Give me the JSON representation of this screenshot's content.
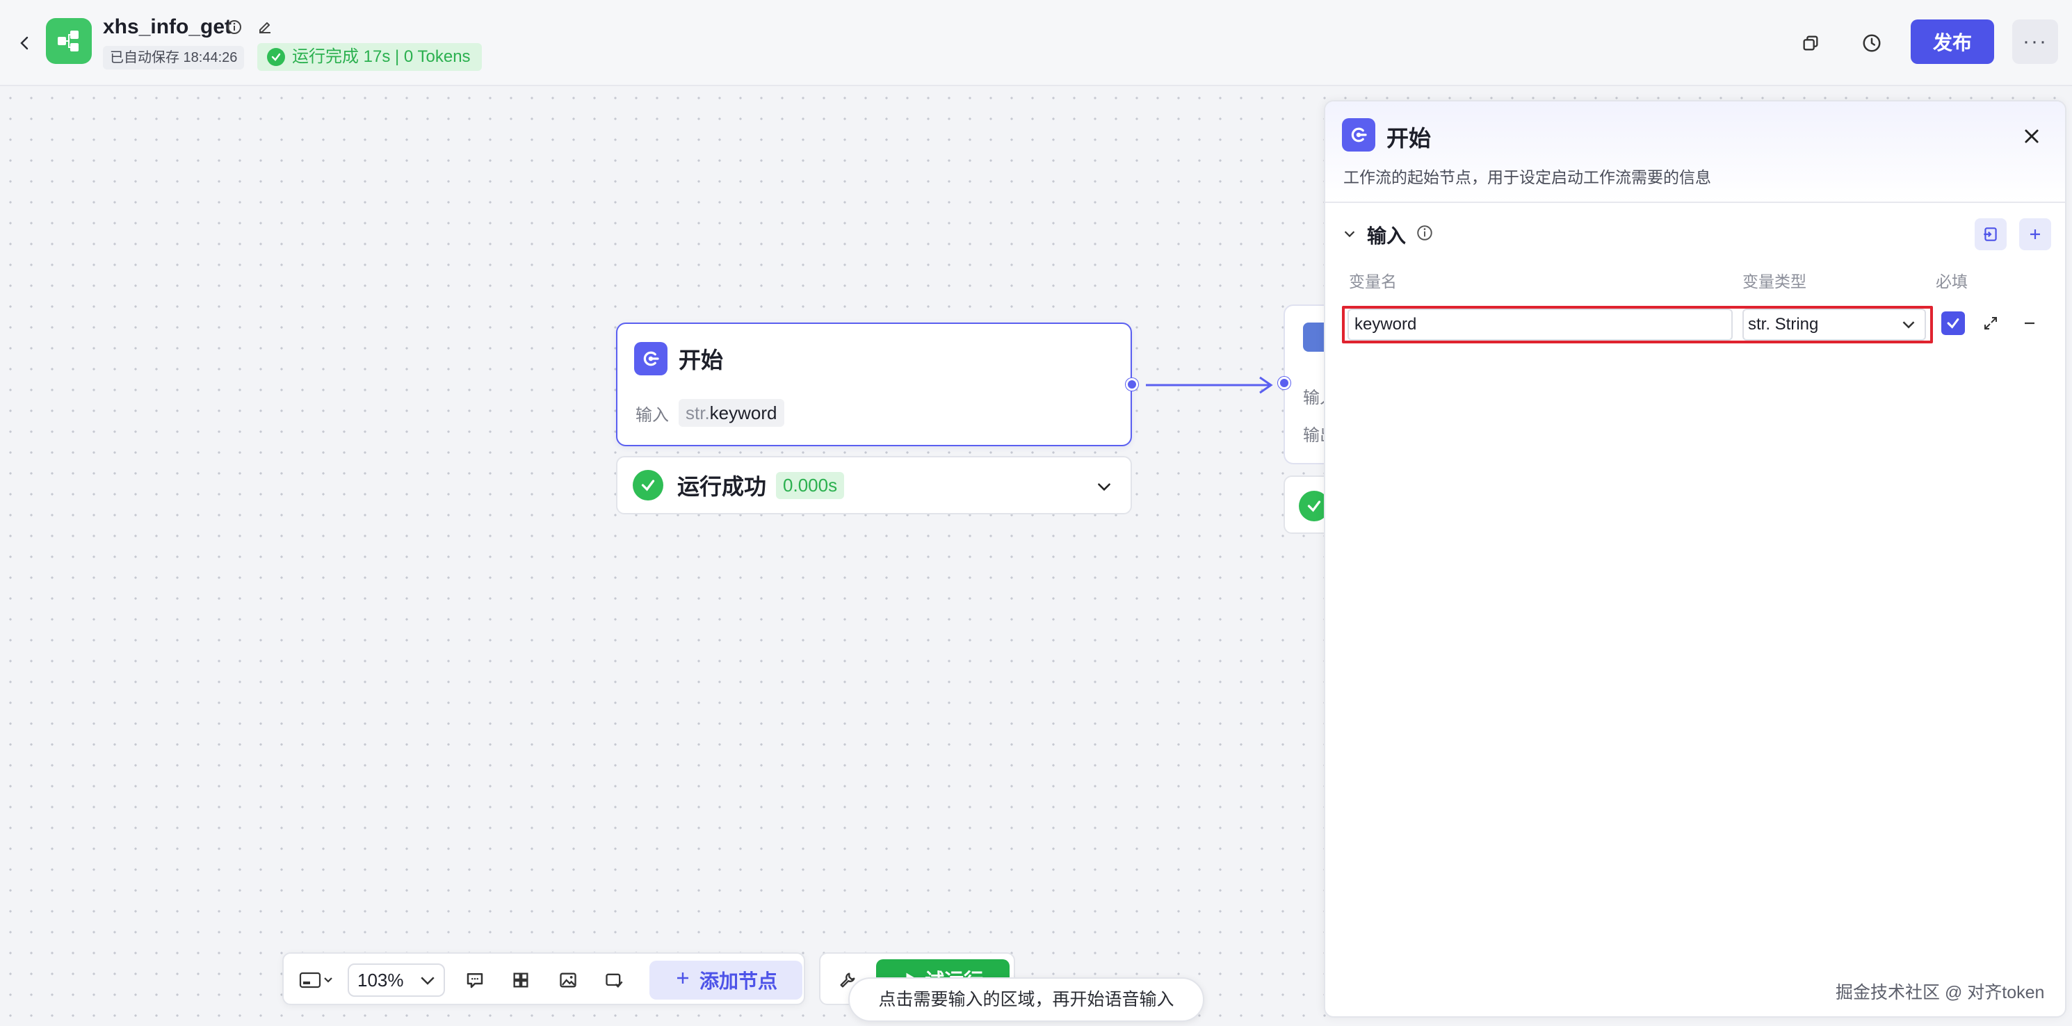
{
  "topbar": {
    "app_title": "xhs_info_get",
    "saved_text": "已自动保存 18:44:26",
    "run_status": "运行完成 17s | 0 Tokens",
    "publish_label": "发布",
    "more_label": "···"
  },
  "canvas": {
    "start_node": {
      "title": "开始",
      "input_label": "输入",
      "var_type": "str.",
      "var_name": "keyword"
    },
    "start_result": {
      "label": "运行成功",
      "time": "0.000s"
    },
    "next_node": {
      "input_label_partial": "输入",
      "output_label_partial": "输出"
    }
  },
  "bottom_toolbar": {
    "zoom": "103%",
    "add_node_label": "添加节点",
    "test_run_label": "试运行",
    "voice_tip": "点击需要输入的区域，再开始语音输入"
  },
  "panel": {
    "title": "开始",
    "description": "工作流的起始节点，用于设定启动工作流需要的信息",
    "section_title": "输入",
    "columns": {
      "name": "变量名",
      "type": "变量类型",
      "required": "必填"
    },
    "variable": {
      "name": "keyword",
      "type": "str. String",
      "required": true
    }
  },
  "watermark": "掘金技术社区 @ 对齐token",
  "colors": {
    "primary": "#4d53e8",
    "success": "#2fbd55",
    "highlight": "#e0232f"
  }
}
